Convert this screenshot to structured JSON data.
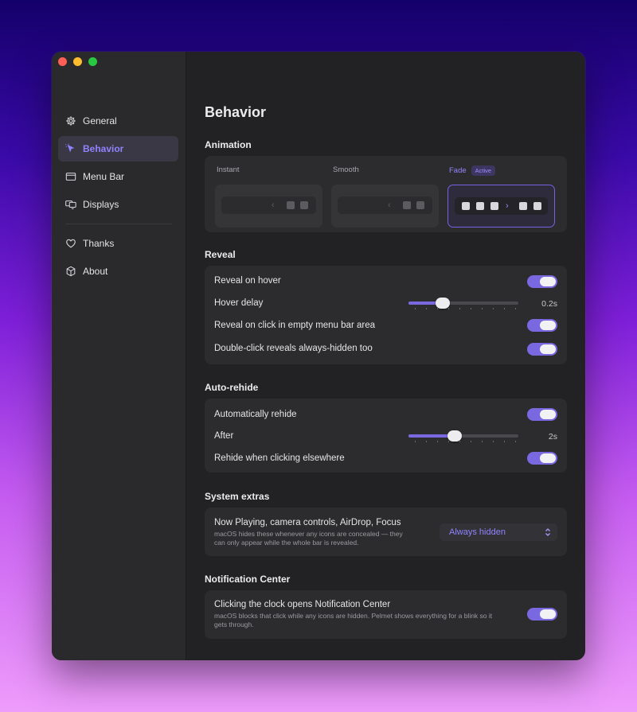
{
  "sidebar": {
    "items": [
      {
        "label": "General",
        "icon": "gear-icon"
      },
      {
        "label": "Behavior",
        "icon": "cursor-icon"
      },
      {
        "label": "Menu Bar",
        "icon": "menubar-icon"
      },
      {
        "label": "Displays",
        "icon": "displays-icon"
      },
      {
        "label": "Thanks",
        "icon": "heart-icon"
      },
      {
        "label": "About",
        "icon": "cube-icon"
      }
    ],
    "active": "Behavior"
  },
  "main": {
    "title": "Behavior",
    "animation": {
      "section_title": "Animation",
      "options": [
        {
          "label": "Instant"
        },
        {
          "label": "Smooth"
        },
        {
          "label": "Fade",
          "badge": "Active"
        }
      ],
      "selected": "Fade"
    },
    "reveal": {
      "section_title": "Reveal",
      "rows": {
        "reveal_on_hover": {
          "label": "Reveal on hover",
          "on": true
        },
        "hover_delay": {
          "label": "Hover delay",
          "value": "0.2s",
          "fraction": 0.28
        },
        "reveal_on_click": {
          "label": "Reveal on click in empty menu bar area",
          "on": true
        },
        "double_click": {
          "label": "Double-click reveals always-hidden too",
          "on": true
        }
      }
    },
    "autorehide": {
      "section_title": "Auto-rehide",
      "rows": {
        "auto_rehide": {
          "label": "Automatically rehide",
          "on": true
        },
        "after": {
          "label": "After",
          "value": "2s",
          "fraction": 0.41
        },
        "rehide_click": {
          "label": "Rehide when clicking elsewhere",
          "on": true
        }
      }
    },
    "system_extras": {
      "section_title": "System extras",
      "label": "Now Playing, camera controls, AirDrop, Focus",
      "sub": "macOS hides these whenever any icons are concealed — they can only appear while the whole bar is revealed.",
      "select_value": "Always hidden"
    },
    "notification_center": {
      "section_title": "Notification Center",
      "label": "Clicking the clock opens Notification Center",
      "sub": "macOS blocks that click while any icons are hidden. Pelmet shows everything for a blink so it gets through.",
      "on": true
    }
  },
  "colors": {
    "accent": "#7a68e0",
    "accent_text": "#8f83ff",
    "window_bg": "#222224",
    "sidebar_bg": "#2a2a2c",
    "card_bg": "#2c2c2e"
  }
}
